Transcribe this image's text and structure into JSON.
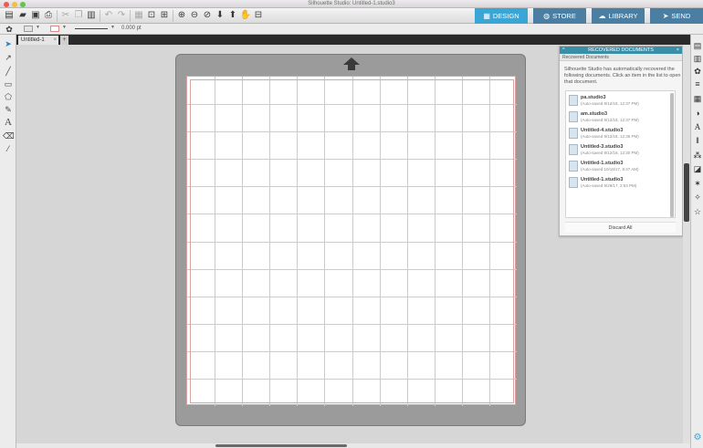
{
  "window": {
    "title": "Silhouette Studio: Untitled-1.studio3",
    "traffic_lights": [
      "#ee5a52",
      "#f5be3f",
      "#5fc54e"
    ]
  },
  "toolbar": {
    "icons": [
      "new-icon",
      "open-icon",
      "save-icon",
      "print-icon",
      "cut-icon",
      "copy-icon",
      "paste-icon",
      "undo-icon",
      "redo-icon",
      "select-all-icon",
      "deselect-icon",
      "zoom-in-icon",
      "zoom-out-icon",
      "zoom-fit-icon",
      "move-down-icon",
      "move-up-icon",
      "pan-icon",
      "fit-page-icon"
    ],
    "tabs": [
      {
        "label": "DESIGN",
        "icon": "grid-icon",
        "active": true
      },
      {
        "label": "STORE",
        "icon": "globe-icon",
        "active": false
      },
      {
        "label": "LIBRARY",
        "icon": "cloud-icon",
        "active": false
      },
      {
        "label": "SEND",
        "icon": "send-icon",
        "active": false
      }
    ]
  },
  "stylebar": {
    "point_value": "0.000",
    "point_unit": "pt"
  },
  "document_tab": {
    "label": "Untitled-1",
    "close": "×",
    "add": "+"
  },
  "recovered_panel": {
    "title": "RECOVERED DOCUMENTS",
    "subtitle": "Recovered Documents",
    "message": "Silhouette Studio has automatically recovered the following documents. Click an item in the list to open that document.",
    "documents": [
      {
        "name": "pa.studio3",
        "saved": "(Auto-saved 8/12/18, 12:37 PM)"
      },
      {
        "name": "am.studio3",
        "saved": "(Auto-saved 8/12/18, 12:37 PM)"
      },
      {
        "name": "Untitled-4.studio3",
        "saved": "(Auto-saved 8/12/18, 12:36 PM)"
      },
      {
        "name": "Untitled-3.studio3",
        "saved": "(Auto-saved 8/12/18, 12:30 PM)"
      },
      {
        "name": "Untitled-1.studio3",
        "saved": "(Auto-saved 10/18/17, 8:47 AM)"
      },
      {
        "name": "Untitled-1.studio3",
        "saved": "(Auto-saved 8/29/17, 2:53 PM)"
      }
    ],
    "discard_label": "Discard All"
  },
  "colors": {
    "accent": "#3aa6d6",
    "mat": "#9b9b9b",
    "grid_line": "#cccccc",
    "cut_border": "#d9a3a3"
  }
}
